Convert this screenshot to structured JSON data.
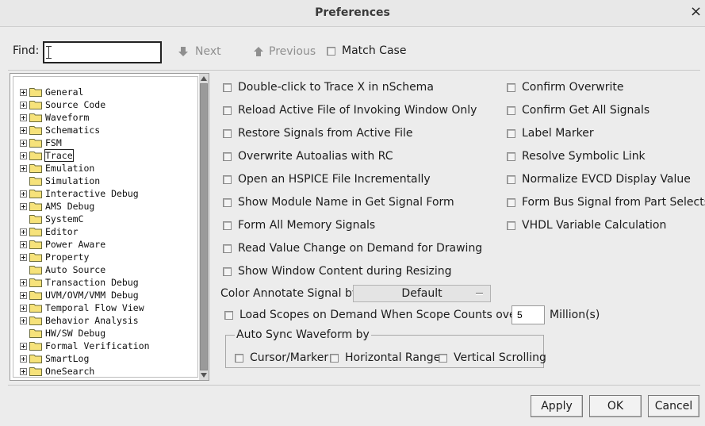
{
  "window": {
    "title": "Preferences",
    "close_glyph": "×"
  },
  "find": {
    "label": "Find:",
    "value": "",
    "next_label": "Next",
    "previous_label": "Previous",
    "match_case_label": "Match Case"
  },
  "tree": {
    "items": [
      {
        "label": "General",
        "expandable": true
      },
      {
        "label": "Source Code",
        "expandable": true
      },
      {
        "label": "Waveform",
        "expandable": true
      },
      {
        "label": "Schematics",
        "expandable": true
      },
      {
        "label": "FSM",
        "expandable": true
      },
      {
        "label": "Trace",
        "expandable": true,
        "selected": true
      },
      {
        "label": "Emulation",
        "expandable": true
      },
      {
        "label": "Simulation",
        "expandable": false
      },
      {
        "label": "Interactive Debug",
        "expandable": true
      },
      {
        "label": "AMS Debug",
        "expandable": true
      },
      {
        "label": "SystemC",
        "expandable": false
      },
      {
        "label": "Editor",
        "expandable": true
      },
      {
        "label": "Power Aware",
        "expandable": true
      },
      {
        "label": "Property",
        "expandable": true
      },
      {
        "label": "Auto Source",
        "expandable": false
      },
      {
        "label": "Transaction Debug",
        "expandable": true
      },
      {
        "label": "UVM/OVM/VMM Debug",
        "expandable": true
      },
      {
        "label": "Temporal Flow View",
        "expandable": true
      },
      {
        "label": "Behavior Analysis",
        "expandable": true
      },
      {
        "label": "HW/SW Debug",
        "expandable": false
      },
      {
        "label": "Formal Verification",
        "expandable": true
      },
      {
        "label": "SmartLog",
        "expandable": true
      },
      {
        "label": "OneSearch",
        "expandable": true
      }
    ]
  },
  "options_left": [
    {
      "label": "Double-click to Trace X in nSchema",
      "checked": false
    },
    {
      "label": "Reload Active File of Invoking Window Only",
      "checked": false
    },
    {
      "label": "Restore Signals from Active File",
      "checked": false
    },
    {
      "label": "Overwrite Autoalias with RC",
      "checked": false
    },
    {
      "label": "Open an HSPICE File Incrementally",
      "checked": false
    },
    {
      "label": "Show Module Name in Get Signal Form",
      "checked": false
    },
    {
      "label": "Form All Memory Signals",
      "checked": false
    },
    {
      "label": "Read Value Change on Demand for Drawing",
      "checked": false
    },
    {
      "label": "Show Window Content during Resizing",
      "checked": false
    }
  ],
  "options_right": [
    {
      "label": "Confirm Overwrite",
      "checked": false
    },
    {
      "label": "Confirm Get All Signals",
      "checked": false
    },
    {
      "label": "Label Marker",
      "checked": false
    },
    {
      "label": "Resolve Symbolic Link",
      "checked": false
    },
    {
      "label": "Normalize EVCD Display Value",
      "checked": false
    },
    {
      "label": "Form Bus Signal from Part Selects",
      "checked": false
    },
    {
      "label": "VHDL Variable Calculation",
      "checked": false
    }
  ],
  "color_annotate": {
    "label": "Color Annotate Signal by:",
    "selected": "Default"
  },
  "load_scopes": {
    "label": "Load Scopes on Demand When Scope Counts over:",
    "value": "5",
    "unit": "Million(s)",
    "checked": false
  },
  "auto_sync": {
    "title": "Auto Sync Waveform  by",
    "options": [
      {
        "label": "Cursor/Marker",
        "checked": false
      },
      {
        "label": "Horizontal Range",
        "checked": false
      },
      {
        "label": "Vertical Scrolling",
        "checked": false
      }
    ]
  },
  "buttons": {
    "apply": "Apply",
    "ok": "OK",
    "cancel": "Cancel"
  },
  "icons": {
    "close": "close-icon",
    "next": "arrow-down-icon",
    "previous": "arrow-up-icon",
    "folder": "folder-icon",
    "expand": "plus-box-icon"
  },
  "colors": {
    "folder": "#f6e27a",
    "background": "#ececec"
  }
}
